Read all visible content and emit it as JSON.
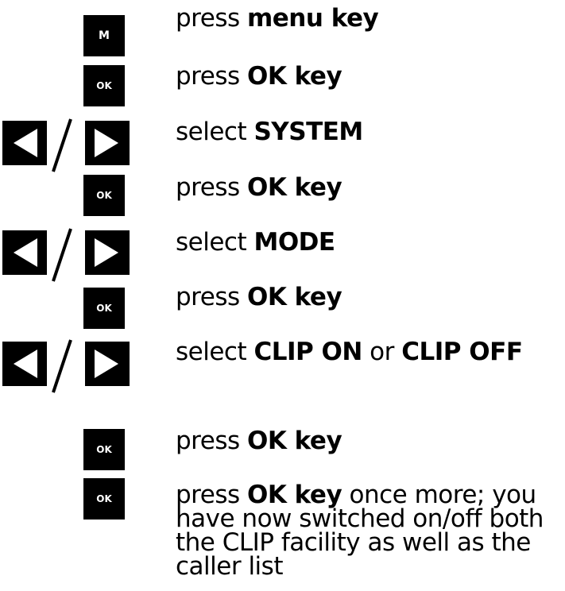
{
  "keys": {
    "menu": "M",
    "ok": "OK"
  },
  "steps": [
    {
      "prefix": "press ",
      "bold": "menu key",
      "mid": "",
      "bold2": "",
      "suffix": ""
    },
    {
      "prefix": "press ",
      "bold": "OK key",
      "mid": "",
      "bold2": "",
      "suffix": ""
    },
    {
      "prefix": "select ",
      "bold": "SYSTEM",
      "mid": "",
      "bold2": "",
      "suffix": ""
    },
    {
      "prefix": "press ",
      "bold": "OK key",
      "mid": "",
      "bold2": "",
      "suffix": ""
    },
    {
      "prefix": "select ",
      "bold": "MODE",
      "mid": "",
      "bold2": "",
      "suffix": ""
    },
    {
      "prefix": "press ",
      "bold": "OK key",
      "mid": "",
      "bold2": "",
      "suffix": ""
    },
    {
      "prefix": "select ",
      "bold": "CLIP ON",
      "mid": " or ",
      "bold2": "CLIP OFF",
      "suffix": ""
    },
    {
      "prefix": "press ",
      "bold": "OK key",
      "mid": "",
      "bold2": "",
      "suffix": ""
    },
    {
      "prefix": "press ",
      "bold": "OK key",
      "mid": "",
      "bold2": "",
      "suffix": " once more; you have now switched on/off both the CLIP facility as well as the caller list"
    }
  ]
}
